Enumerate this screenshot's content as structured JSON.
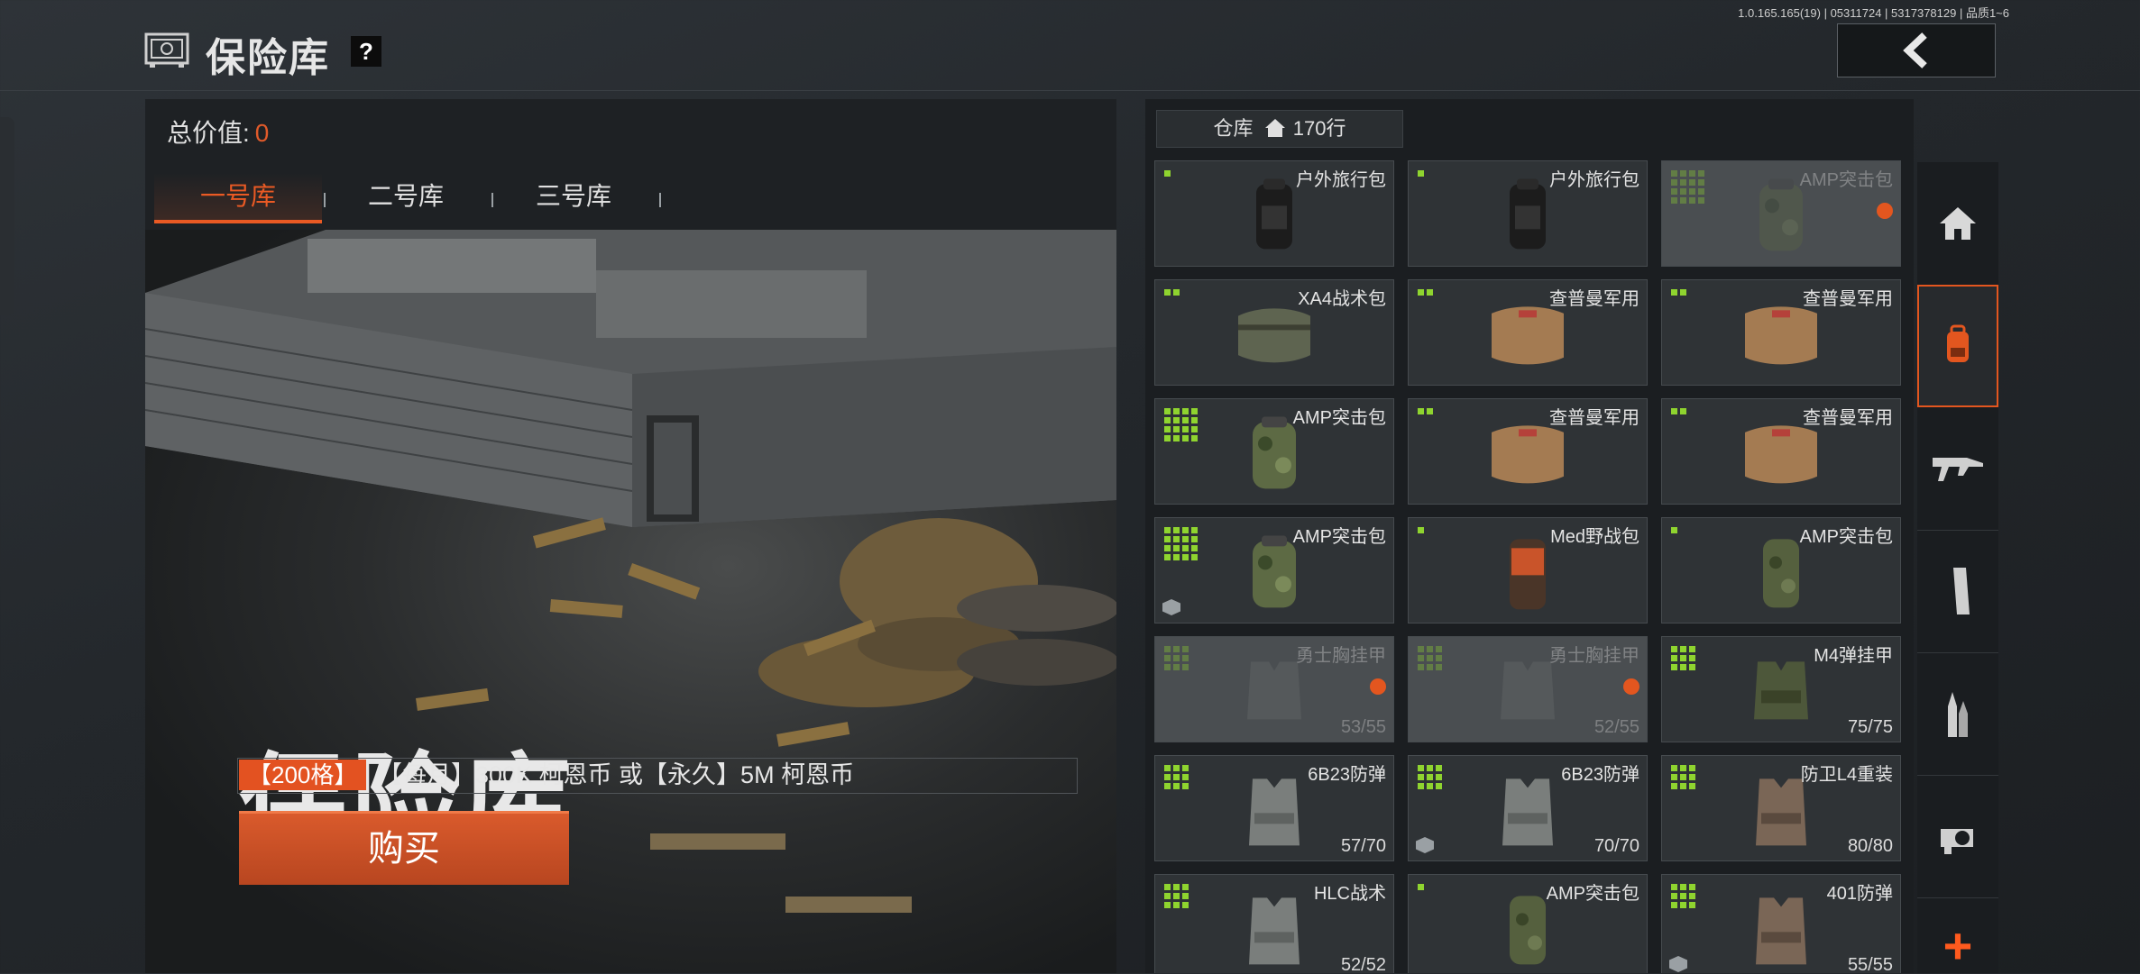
{
  "header": {
    "title": "保险库",
    "help_label": "?",
    "version_info": "1.0.165.165(19) | 05311724 | 5317378129 | 品质1~6"
  },
  "vault": {
    "total_label": "总价值:",
    "total_value": "0",
    "tabs": [
      {
        "label": "一号库",
        "active": true
      },
      {
        "label": "二号库",
        "active": false
      },
      {
        "label": "三号库",
        "active": false
      }
    ],
    "hero_title": "保险库",
    "capacity_tag": "【200格】",
    "price_text": "【每月】300K 柯恩币 或【永久】5M 柯恩币",
    "buy_label": "购买"
  },
  "warehouse": {
    "label": "仓库",
    "count": "170行",
    "items": [
      {
        "name": "户外旅行包",
        "dura": "",
        "dim": false,
        "size": 1,
        "shape": "backpack-black"
      },
      {
        "name": "户外旅行包",
        "dura": "",
        "dim": false,
        "size": 1,
        "shape": "backpack-black"
      },
      {
        "name": "AMP突击包",
        "dura": "",
        "dim": true,
        "size": 16,
        "shape": "backpack-camo",
        "lock": true
      },
      {
        "name": "XA4战术包",
        "dura": "",
        "dim": false,
        "size": 2,
        "shape": "duffel-green"
      },
      {
        "name": "查普曼军用",
        "dura": "",
        "dim": false,
        "size": 2,
        "shape": "duffel-tan"
      },
      {
        "name": "查普曼军用",
        "dura": "",
        "dim": false,
        "size": 2,
        "shape": "duffel-tan"
      },
      {
        "name": "AMP突击包",
        "dura": "",
        "dim": false,
        "size": 16,
        "shape": "backpack-camo"
      },
      {
        "name": "查普曼军用",
        "dura": "",
        "dim": false,
        "size": 2,
        "shape": "duffel-tan"
      },
      {
        "name": "查普曼军用",
        "dura": "",
        "dim": false,
        "size": 2,
        "shape": "duffel-tan"
      },
      {
        "name": "AMP突击包",
        "dura": "",
        "dim": false,
        "size": 16,
        "shape": "backpack-camo",
        "box": true
      },
      {
        "name": "Med野战包",
        "dura": "",
        "dim": false,
        "size": 1,
        "shape": "pack-orange"
      },
      {
        "name": "AMP突击包",
        "dura": "",
        "dim": false,
        "size": 1,
        "shape": "pack-olive"
      },
      {
        "name": "勇士胸挂甲",
        "dura": "53/55",
        "dim": true,
        "size": 9,
        "shape": "rig",
        "lock": true
      },
      {
        "name": "勇士胸挂甲",
        "dura": "52/55",
        "dim": true,
        "size": 9,
        "shape": "rig",
        "lock": true
      },
      {
        "name": "M4弹挂甲",
        "dura": "75/75",
        "dim": false,
        "size": 9,
        "shape": "rig-olive"
      },
      {
        "name": "6B23防弹",
        "dura": "57/70",
        "dim": false,
        "size": 9,
        "shape": "vest-grey"
      },
      {
        "name": "6B23防弹",
        "dura": "70/70",
        "dim": false,
        "size": 9,
        "shape": "vest-grey",
        "box": true
      },
      {
        "name": "防卫L4重装",
        "dura": "80/80",
        "dim": false,
        "size": 9,
        "shape": "vest-brown"
      },
      {
        "name": "HLC战术",
        "dura": "52/52",
        "dim": false,
        "size": 9,
        "shape": "vest-grey"
      },
      {
        "name": "AMP突击包",
        "dura": "",
        "dim": false,
        "size": 1,
        "shape": "pack-olive"
      },
      {
        "name": "401防弹",
        "dura": "55/55",
        "dim": false,
        "size": 9,
        "shape": "vest-brown",
        "box": true
      }
    ]
  },
  "rail": {
    "items": [
      "home-icon",
      "backpack-icon",
      "rifle-icon",
      "magazine-icon",
      "ammo-icon",
      "scope-icon"
    ],
    "active_index": 1,
    "add_label": "+"
  },
  "colors": {
    "accent": "#e3561f",
    "size_indicator": "#8fd42f"
  }
}
